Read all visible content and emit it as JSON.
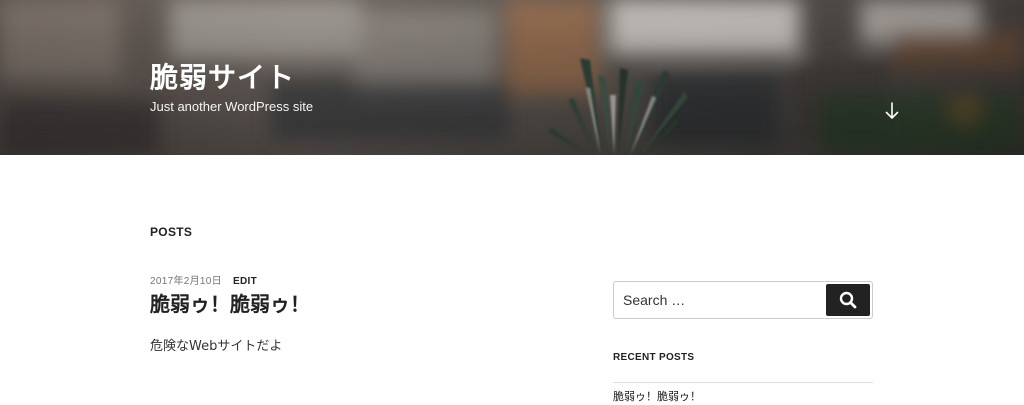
{
  "header": {
    "site_title": "脆弱サイト",
    "site_description": "Just another WordPress site",
    "scroll_icon": "arrow-down-icon"
  },
  "main": {
    "section_title": "POSTS",
    "post": {
      "date": "2017年2月10日",
      "edit_label": "EDIT",
      "title": "脆弱ゥ！脆弱ゥ！",
      "excerpt": "危険なWebサイトだよ"
    }
  },
  "sidebar": {
    "search": {
      "placeholder": "Search …",
      "button_icon": "search-icon"
    },
    "recent_posts": {
      "title": "RECENT POSTS",
      "items": [
        "脆弱ゥ！脆弱ゥ！"
      ]
    }
  },
  "colors": {
    "text": "#222222",
    "meta": "#767676",
    "search_button": "#222222",
    "header_text": "#ffffff"
  }
}
